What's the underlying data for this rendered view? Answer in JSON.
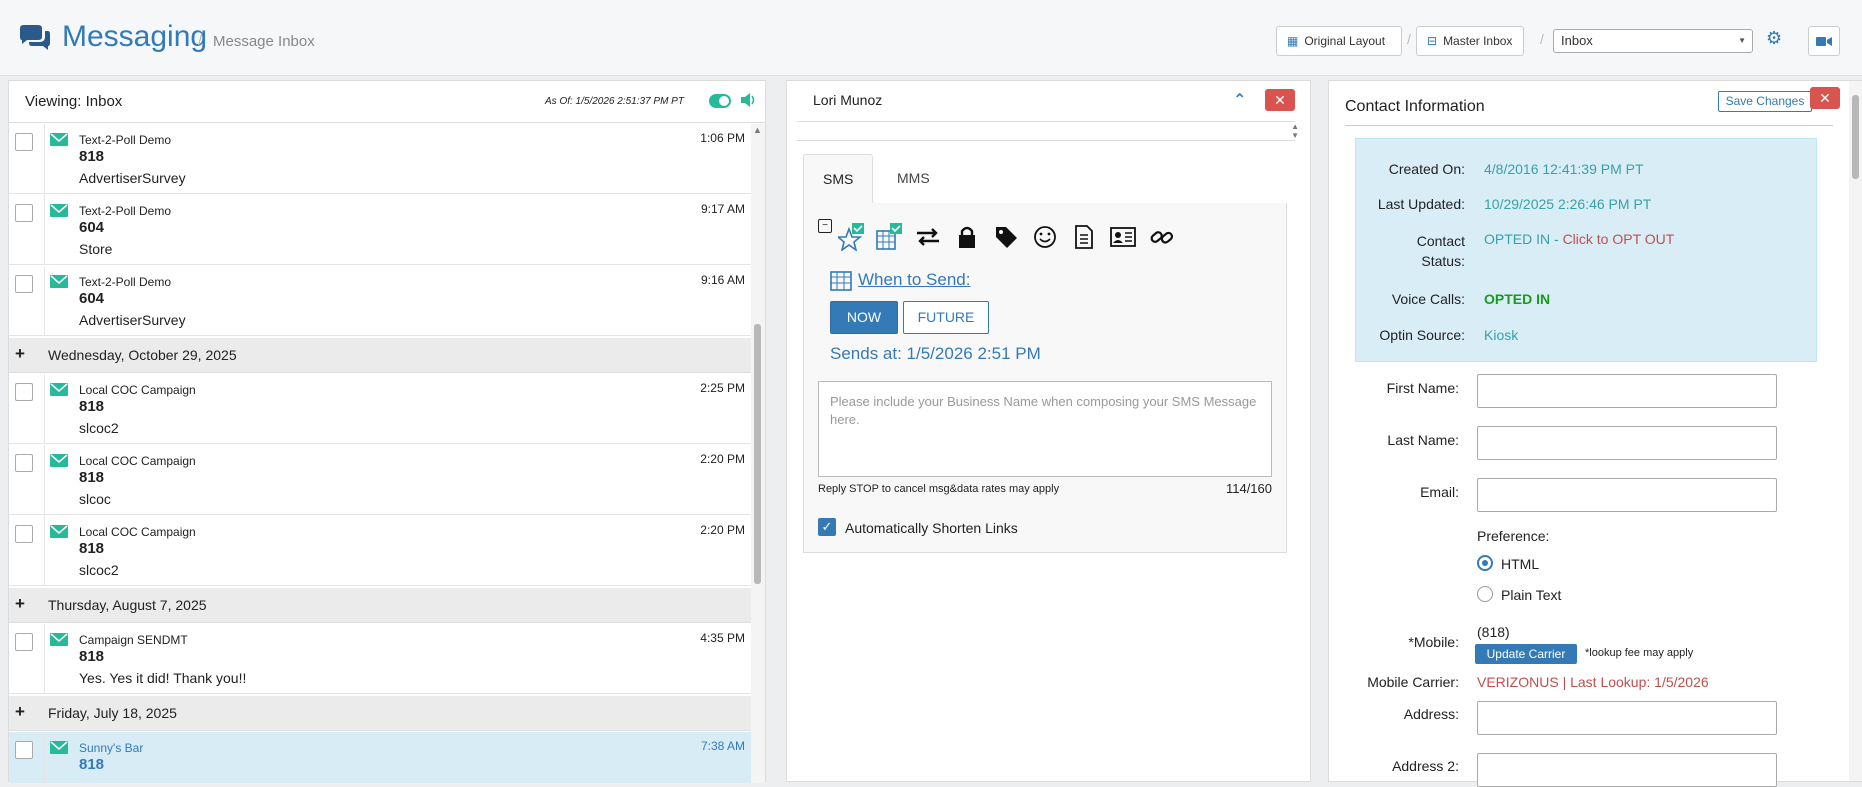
{
  "header": {
    "title": "Messaging",
    "crumb_sep": "/",
    "breadcrumb": "Message Inbox",
    "original_layout": "Original Layout",
    "master_inbox": "Master Inbox",
    "sep": "/",
    "inbox_select": "Inbox"
  },
  "inbox": {
    "viewing": "Viewing: Inbox",
    "as_of": "As Of: 1/5/2026 2:51:37 PM PT",
    "messages": [
      {
        "campaign": "Text-2-Poll Demo",
        "time": "1:06 PM",
        "number": "818",
        "body": "AdvertiserSurvey"
      },
      {
        "campaign": "Text-2-Poll Demo",
        "time": "9:17 AM",
        "number": "604",
        "body": "Store"
      },
      {
        "campaign": "Text-2-Poll Demo",
        "time": "9:16 AM",
        "number": "604",
        "body": "AdvertiserSurvey"
      },
      {
        "campaign": "Local COC Campaign",
        "time": "2:25 PM",
        "number": "818",
        "body": "slcoc2"
      },
      {
        "campaign": "Local COC Campaign",
        "time": "2:20 PM",
        "number": "818",
        "body": "slcoc"
      },
      {
        "campaign": "Local COC Campaign",
        "time": "2:20 PM",
        "number": "818",
        "body": "slcoc2"
      },
      {
        "campaign": "Campaign SENDMT",
        "time": "4:35 PM",
        "number": "818",
        "body": "Yes. Yes it did! Thank you!!"
      },
      {
        "campaign": "Sunny's Bar",
        "time": "7:38 AM",
        "number": "818",
        "body": ""
      }
    ],
    "days": [
      "Wednesday, October 29, 2025",
      "Thursday, August 7, 2025",
      "Friday, July 18, 2025"
    ],
    "plus": "+"
  },
  "conversation": {
    "contact_name": "Lori Munoz",
    "close": "✕",
    "tabs": [
      "SMS",
      "MMS"
    ],
    "when_to_send": "When to Send:",
    "now": "NOW",
    "future": "FUTURE",
    "sends_at": "Sends at: 1/5/2026 2:51 PM",
    "placeholder": "Please include your Business Name when composing your SMS Message here.",
    "footer": "Reply STOP to cancel msg&data rates may apply",
    "count": "114/160",
    "shorten_links": "Automatically Shorten Links"
  },
  "contact": {
    "title": "Contact Information",
    "save": "Save Changes",
    "close": "✕",
    "info": [
      {
        "k": "Created On:",
        "v": "4/8/2016 12:41:39 PM PT"
      },
      {
        "k": "Last Updated:",
        "v": "10/29/2025 2:26:46 PM PT"
      },
      {
        "k": "Contact Status:",
        "v": "OPTED IN - ",
        "v2": "Click to OPT OUT"
      },
      {
        "k": "Voice Calls:",
        "v": "OPTED IN"
      },
      {
        "k": "Optin Source:",
        "v": "Kiosk"
      }
    ],
    "first_name": "First Name:",
    "last_name": "Last Name:",
    "email": "Email:",
    "preference": "Preference:",
    "html": "HTML",
    "plain": "Plain Text",
    "mobile": "*Mobile:",
    "mobile_val": "(818)",
    "update_carrier": "Update Carrier",
    "lookup_fee": "*lookup fee may apply",
    "carrier_label": "Mobile Carrier:",
    "carrier_val": "VERIZONUS |  Last Lookup: 1/5/2026",
    "address": "Address:",
    "address2": "Address 2:"
  },
  "colors": {
    "accent": "#337ab7",
    "danger": "#d9534f",
    "success": "#26b99a",
    "info_bg": "#d9edf7"
  }
}
